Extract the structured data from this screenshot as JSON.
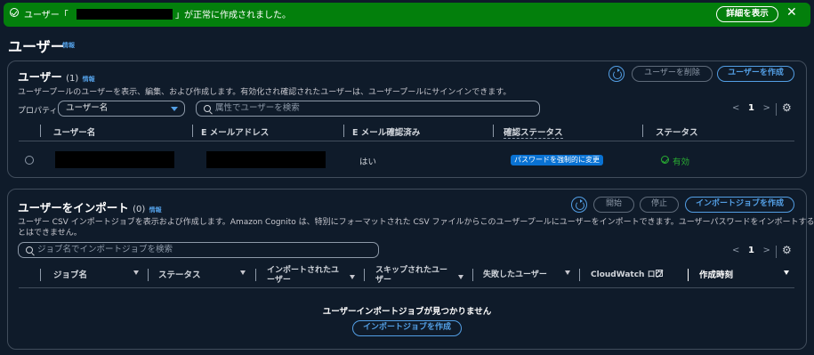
{
  "flash": {
    "message_prefix": "ユーザー「",
    "message_suffix": "」が正常に作成されました。",
    "details_button": "詳細を表示",
    "close": "✕"
  },
  "page": {
    "title": "ユーザー",
    "info": "情報"
  },
  "users_panel": {
    "title": "ユーザー",
    "count": "(1)",
    "info": "情報",
    "description": "ユーザープールのユーザーを表示、編集、および作成します。有効化され確認されたユーザーは、ユーザープールにサインインできます。",
    "delete_button": "ユーザーを削除",
    "create_button": "ユーザーを作成",
    "property_label": "プロパティ:",
    "property_value": "ユーザー名",
    "search_placeholder": "属性でユーザーを検索",
    "pager": {
      "prev": "<",
      "page": "1",
      "next": ">"
    },
    "columns": [
      "ユーザー名",
      "E メールアドレス",
      "E メール確認済み",
      "確認ステータス",
      "ステータス"
    ],
    "rows": [
      {
        "email_verified": "はい",
        "confirmation_status": "パスワードを強制的に変更",
        "status": "有効"
      }
    ]
  },
  "import_panel": {
    "title": "ユーザーをインポート",
    "count": "(0)",
    "info": "情報",
    "description_line1": "ユーザー CSV インポートジョブを表示および作成します。Amazon Cognito は、特別にフォーマットされた CSV ファイルからこのユーザープールにユーザーをインポートできます。ユーザーパスワードをインポートするこ",
    "description_line2": "とはできません。",
    "start_button": "開始",
    "stop_button": "停止",
    "create_job_button": "インポートジョブを作成",
    "search_placeholder": "ジョブ名でインポートジョブを検索",
    "pager": {
      "prev": "<",
      "page": "1",
      "next": ">"
    },
    "columns": {
      "job_name": "ジョブ名",
      "status": "ステータス",
      "imported_1": "インポートされたユ",
      "imported_2": "ーザー",
      "skipped_1": "スキップされたユー",
      "skipped_2": "ザー",
      "failed": "失敗したユーザー",
      "cloudwatch": "CloudWatch ログ",
      "created": "作成時刻"
    },
    "empty_message": "ユーザーインポートジョブが見つかりません",
    "empty_create_button": "インポートジョブを作成"
  },
  "colors": {
    "flash": "#037f0c",
    "accent": "#539fe5",
    "badge": "#0972d3",
    "success": "#29ad32",
    "background": "#0f1b2a"
  }
}
